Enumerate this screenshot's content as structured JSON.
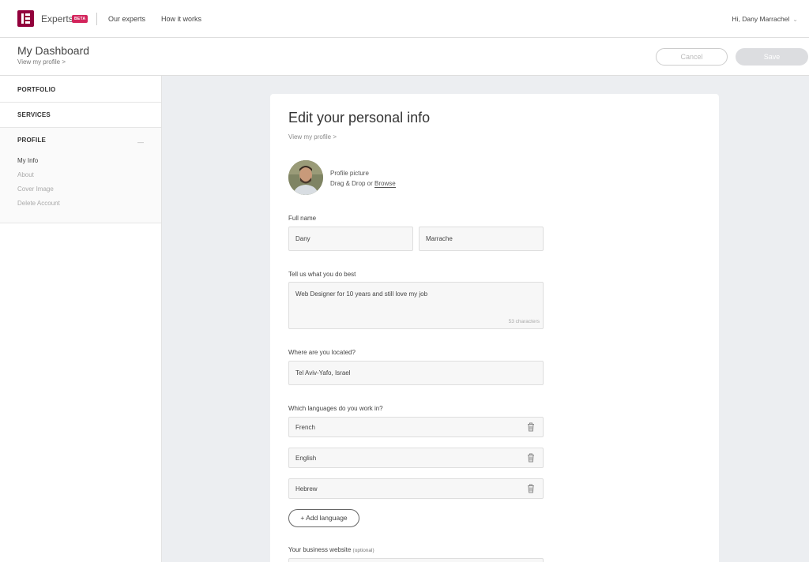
{
  "topnav": {
    "brand": "Experts",
    "beta": "BETA",
    "links": [
      "Our experts",
      "How it works"
    ],
    "greeting": "Hi, Dany Marrachel"
  },
  "header": {
    "title": "My Dashboard",
    "profile_link": "View my profile >",
    "cancel_label": "Cancel",
    "save_label": "Save"
  },
  "sidebar": {
    "portfolio": "PORTFOLIO",
    "services": "SERVICES",
    "profile": "PROFILE",
    "collapse": "—",
    "items": [
      "My Info",
      "About",
      "Cover Image",
      "Delete Account"
    ]
  },
  "form": {
    "title": "Edit your personal info",
    "profile_link": "View my profile >",
    "picture_label": "Profile picture",
    "picture_hint_prefix": "Drag & Drop or ",
    "picture_hint_link": "Browse",
    "fullname_label": "Full name",
    "first_name": "Dany",
    "last_name": "Marrache",
    "bio_label": "Tell us what you do best",
    "bio_value": "Web Designer for 10 years and still love my job",
    "bio_counter": "53 characters",
    "location_label": "Where are you located?",
    "location_value": "Tel Aviv-Yafo, Israel",
    "languages_label": "Which languages do you work in?",
    "languages": [
      "French",
      "English",
      "Hebrew"
    ],
    "add_language": "+ Add language",
    "website_label": "Your business website",
    "website_optional": "(optional)"
  },
  "colors": {
    "brand": "#92003b",
    "beta": "#d3245c",
    "background": "#eceef1"
  }
}
